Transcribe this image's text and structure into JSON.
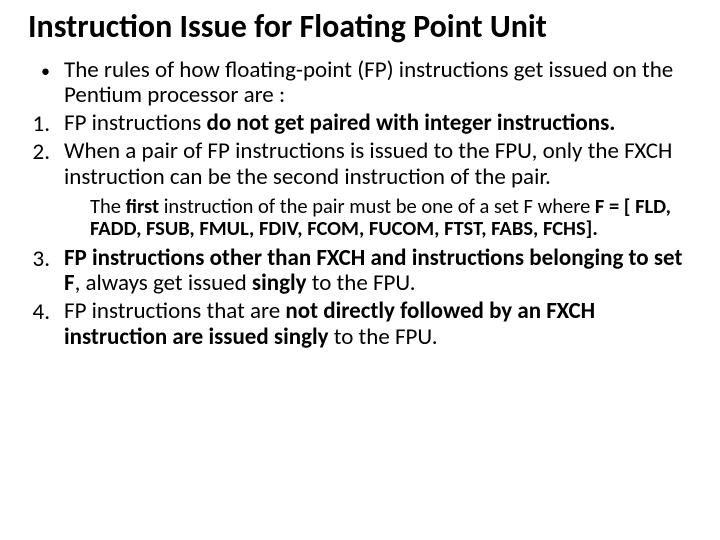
{
  "title": "Instruction Issue for Floating Point Unit",
  "intro": "The rules of how floating-point (FP) instructions get issued on the Pentium processor are :",
  "r1_a": "FP instructions ",
  "r1_b": "do not get paired with integer instructions.",
  "r2": "When a pair of FP instructions is issued to the FPU, only the FXCH instruction can be the second instruction of the pair.",
  "sub_a": "The ",
  "sub_b": "first",
  "sub_c": " instruction of the pair must be one of a set F where ",
  "sub_d": "F = [ FLD, FADD, FSUB, FMUL, FDIV, FCOM, FUCOM, FTST, FABS, FCHS].",
  "r3_a": "FP instructions other than FXCH and instructions belonging to set F",
  "r3_b": ", always get issued ",
  "r3_c": "singly",
  "r3_d": " to the FPU.",
  "r4_a": "FP instructions that are ",
  "r4_b": "not directly followed by an FXCH instruction are issued singly ",
  "r4_c": "to the FPU."
}
